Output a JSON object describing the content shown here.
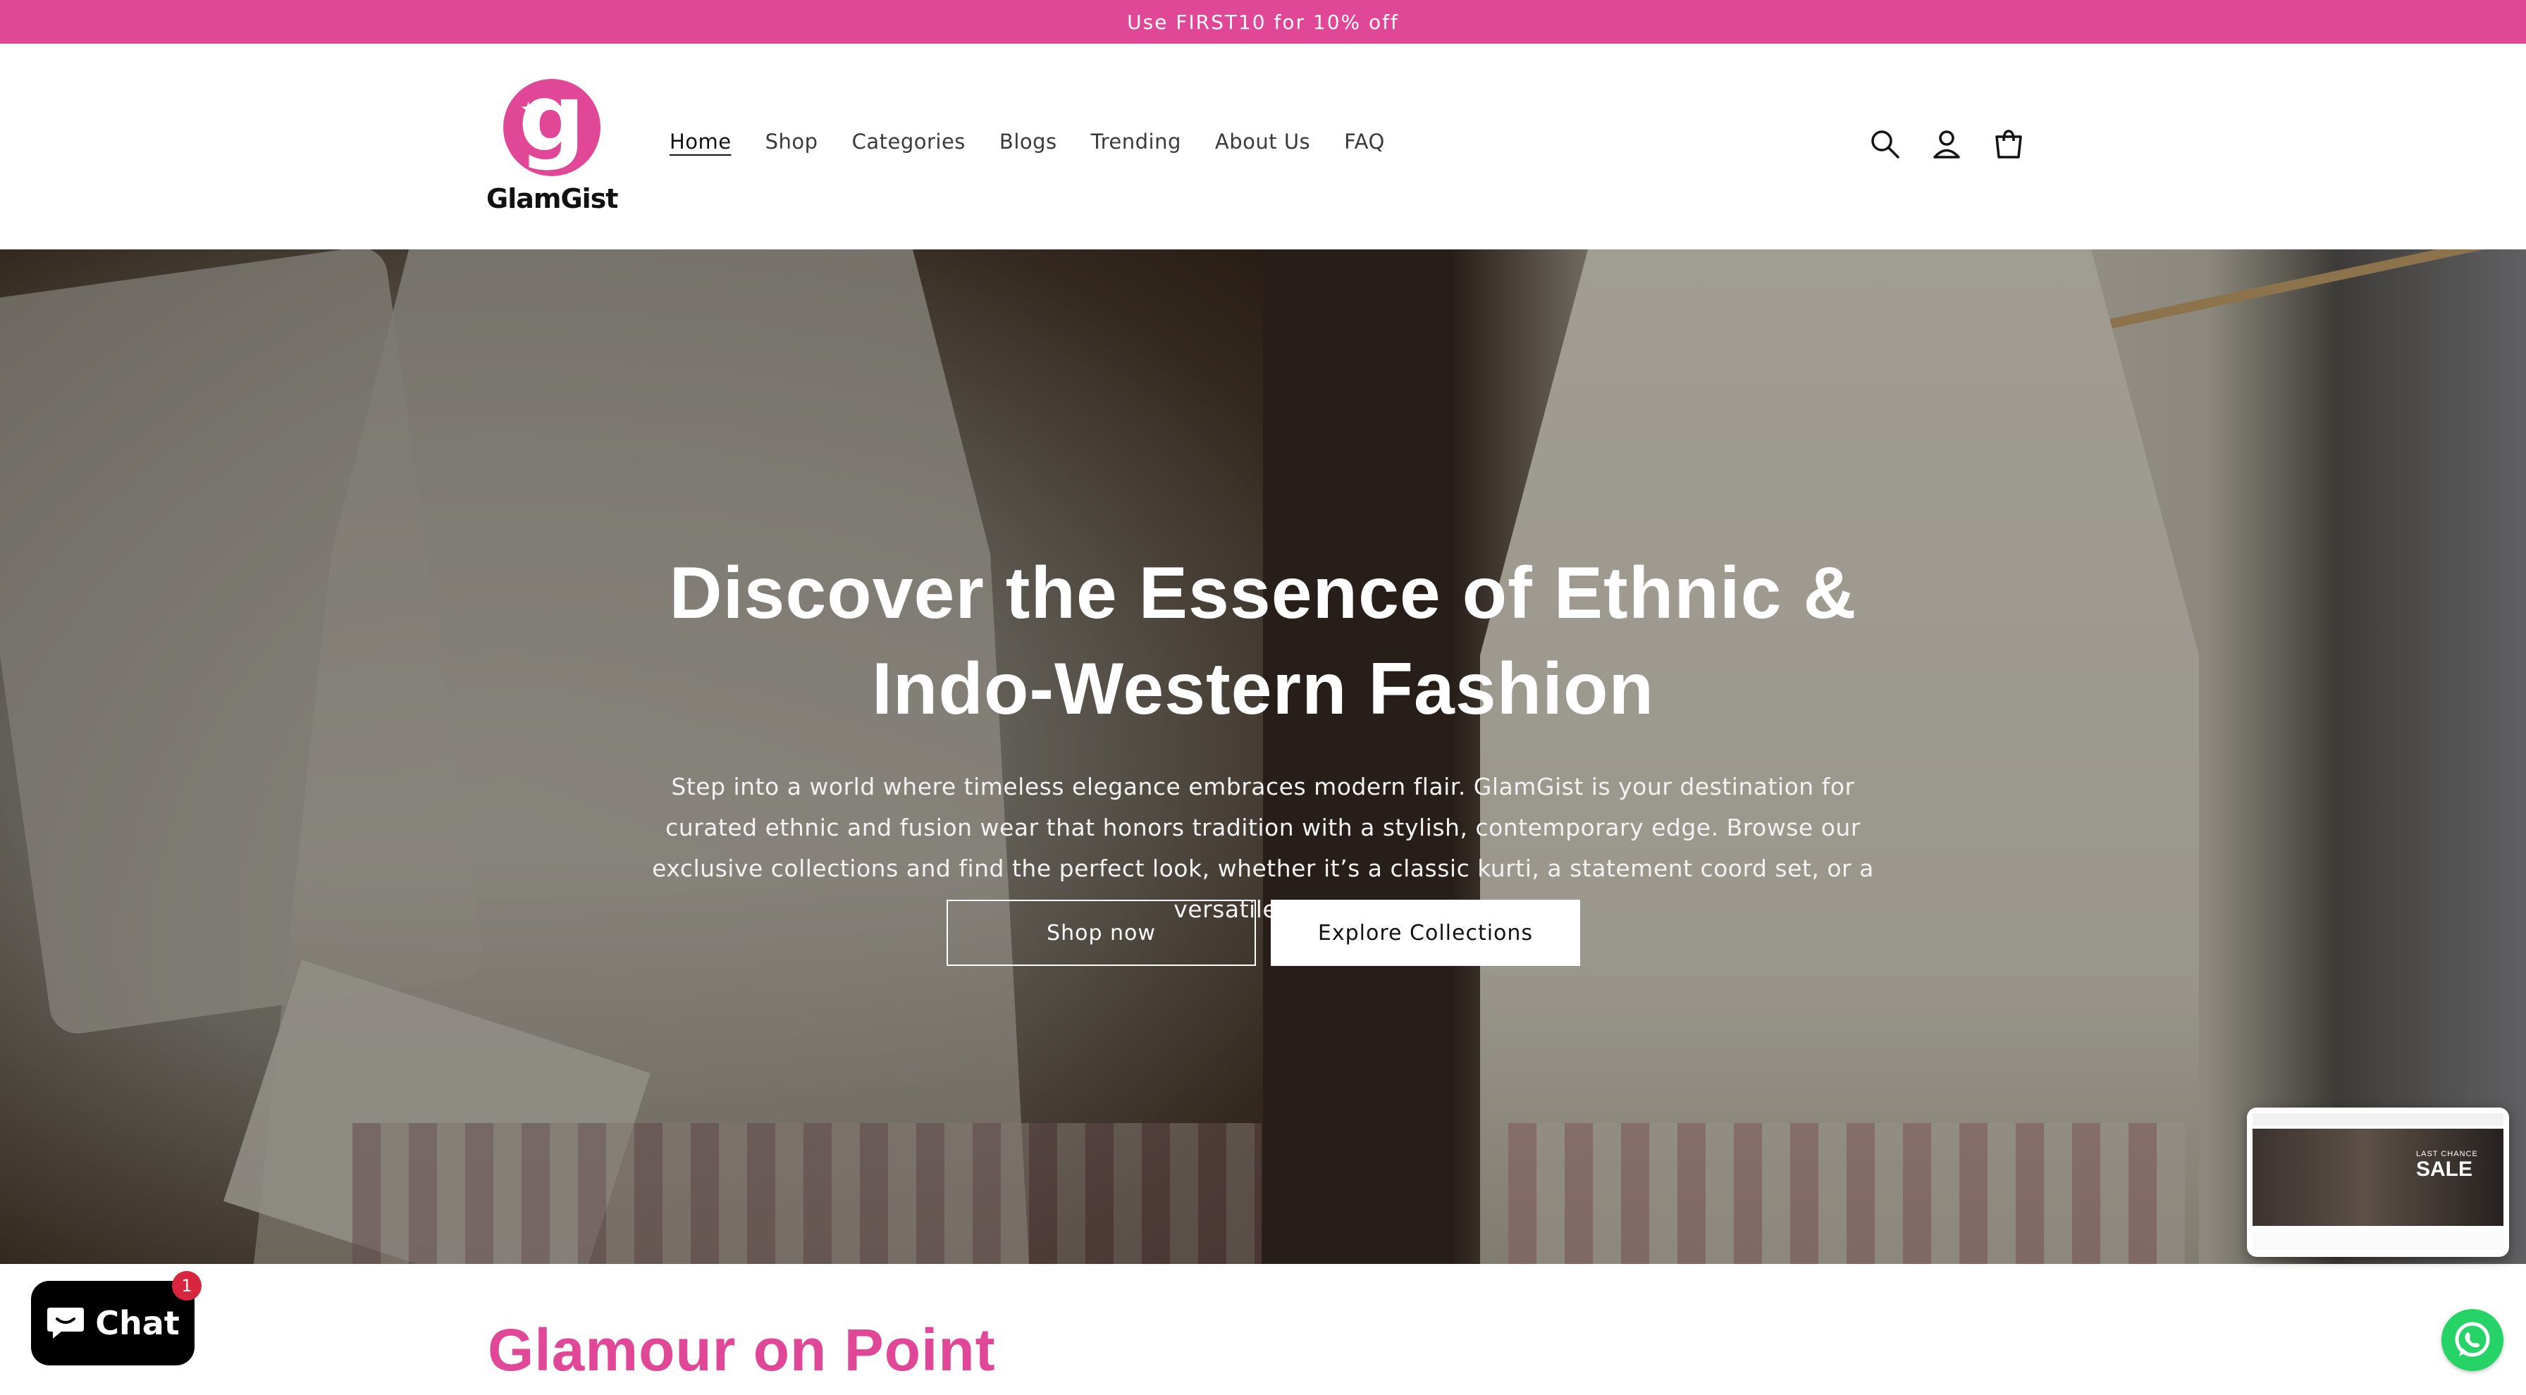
{
  "announcement": {
    "text": "Use FIRST10 for 10% off"
  },
  "brand": {
    "name": "GlamGist",
    "color": "#e04796"
  },
  "nav": {
    "items": [
      {
        "label": "Home",
        "active": true
      },
      {
        "label": "Shop",
        "active": false
      },
      {
        "label": "Categories",
        "active": false
      },
      {
        "label": "Blogs",
        "active": false
      },
      {
        "label": "Trending",
        "active": false
      },
      {
        "label": "About Us",
        "active": false
      },
      {
        "label": "FAQ",
        "active": false
      }
    ]
  },
  "header_icons": [
    "search-icon",
    "account-icon",
    "cart-icon"
  ],
  "hero": {
    "title": "Discover the Essence of Ethnic & Indo-Western Fashion",
    "text": "Step into a world where timeless elegance embraces modern flair. GlamGist is your destination for curated ethnic and fusion wear that honors tradition with a stylish, contemporary edge. Browse our exclusive collections and find the perfect look, whether it’s a classic kurti, a statement coord set, or a versatile tunic.",
    "primary_button": "Shop now",
    "secondary_button": "Explore Collections"
  },
  "section": {
    "title": "Glamour on Point"
  },
  "chat": {
    "label": "Chat",
    "badge": "1"
  },
  "video_thumb": {
    "line1": "LAST CHANCE",
    "line2": "SALE"
  }
}
